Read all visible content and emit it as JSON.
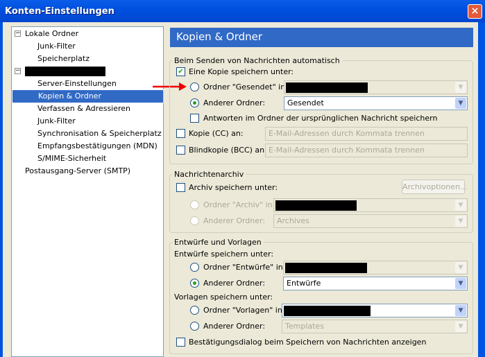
{
  "window": {
    "title": "Konten-Einstellungen",
    "close": "×"
  },
  "tree": {
    "items": [
      {
        "label": "Lokale Ordner",
        "expander": "−"
      },
      {
        "label": "Junk-Filter"
      },
      {
        "label": "Speicherplatz"
      },
      {
        "label": "",
        "expander": "−",
        "redacted": true
      },
      {
        "label": "Server-Einstellungen"
      },
      {
        "label": "Kopien & Ordner",
        "selected": true
      },
      {
        "label": "Verfassen & Adressieren"
      },
      {
        "label": "Junk-Filter"
      },
      {
        "label": "Synchronisation & Speicherplatz"
      },
      {
        "label": "Empfangsbestätigungen (MDN)"
      },
      {
        "label": "S/MIME-Sicherheit"
      },
      {
        "label": "Postausgang-Server (SMTP)"
      }
    ]
  },
  "panel": {
    "title": "Kopien & Ordner",
    "sending": {
      "legend": "Beim Senden von Nachrichten automatisch",
      "save_copy": "Eine Kopie speichern unter:",
      "sent_folder": "Ordner \"Gesendet\" in:",
      "other_folder": "Anderer Ordner:",
      "other_value": "Gesendet",
      "replies": "Antworten im Ordner der ursprünglichen Nachricht speichern",
      "cc": "Kopie (CC) an:",
      "bcc": "Blindkopie (BCC) an:",
      "placeholder": "E-Mail-Adressen durch Kommata trennen"
    },
    "archive": {
      "legend": "Nachrichtenarchiv",
      "save": "Archiv speichern unter:",
      "options": "Archivoptionen...",
      "archive_folder": "Ordner \"Archiv\" in:",
      "other_folder": "Anderer Ordner:",
      "other_value": "Archives"
    },
    "drafts": {
      "legend": "Entwürfe und Vorlagen",
      "drafts_label": "Entwürfe speichern unter:",
      "drafts_folder": "Ordner \"Entwürfe\" in:",
      "other_folder": "Anderer Ordner:",
      "drafts_value": "Entwürfe",
      "templates_label": "Vorlagen speichern unter:",
      "templates_folder": "Ordner \"Vorlagen\" in:",
      "templates_value": "Templates",
      "confirm": "Bestätigungsdialog beim Speichern von Nachrichten anzeigen"
    }
  }
}
